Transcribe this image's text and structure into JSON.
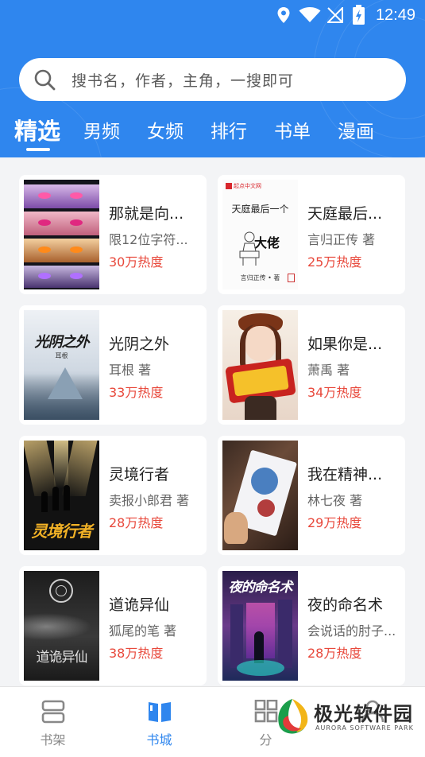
{
  "status_bar": {
    "time": "12:49"
  },
  "search": {
    "placeholder": "搜书名，作者，主角，一搜即可"
  },
  "tabs": [
    {
      "label": "精选",
      "active": true
    },
    {
      "label": "男频"
    },
    {
      "label": "女频"
    },
    {
      "label": "排行"
    },
    {
      "label": "书单"
    },
    {
      "label": "漫画"
    }
  ],
  "books": [
    {
      "title": "那就是向...",
      "author": "限12位字符...",
      "hot": "30万热度"
    },
    {
      "title": "天庭最后...",
      "author": "言归正传 著",
      "hot": "25万热度",
      "cover_text": {
        "publisher": "起点中文网",
        "title": "天庭最后一个",
        "title2": "大佬",
        "author": "言归正传 • 著"
      }
    },
    {
      "title": "光阴之外",
      "author": "耳根 著",
      "hot": "33万热度",
      "cover_text": {
        "title": "光阴之外",
        "author": "耳根"
      }
    },
    {
      "title": "如果你是...",
      "author": "萧禹 著",
      "hot": "34万热度"
    },
    {
      "title": "灵境行者",
      "author": "卖报小郎君 著",
      "hot": "28万热度",
      "cover_text": {
        "title": "灵境行者"
      }
    },
    {
      "title": "我在精神...",
      "author": "林七夜 著",
      "hot": "29万热度"
    },
    {
      "title": "道诡异仙",
      "author": "狐尾的笔 著",
      "hot": "38万热度",
      "cover_text": {
        "title": "道诡异仙"
      }
    },
    {
      "title": "夜的命名术",
      "author": "会说话的肘子...",
      "hot": "28万热度",
      "cover_text": {
        "title": "夜的命名术"
      }
    }
  ],
  "bottom_nav": [
    {
      "label": "书架",
      "icon": "bookshelf-icon"
    },
    {
      "label": "书城",
      "icon": "book-open-icon",
      "active": true
    },
    {
      "label": "分",
      "icon": "grid-icon"
    },
    {
      "label": "",
      "icon": "person-icon"
    }
  ],
  "watermark": {
    "text": "极光软件园",
    "subtext": "AURORA SOFTWARE PARK"
  },
  "colors": {
    "primary": "#2f86ee",
    "hot": "#e8483b"
  }
}
